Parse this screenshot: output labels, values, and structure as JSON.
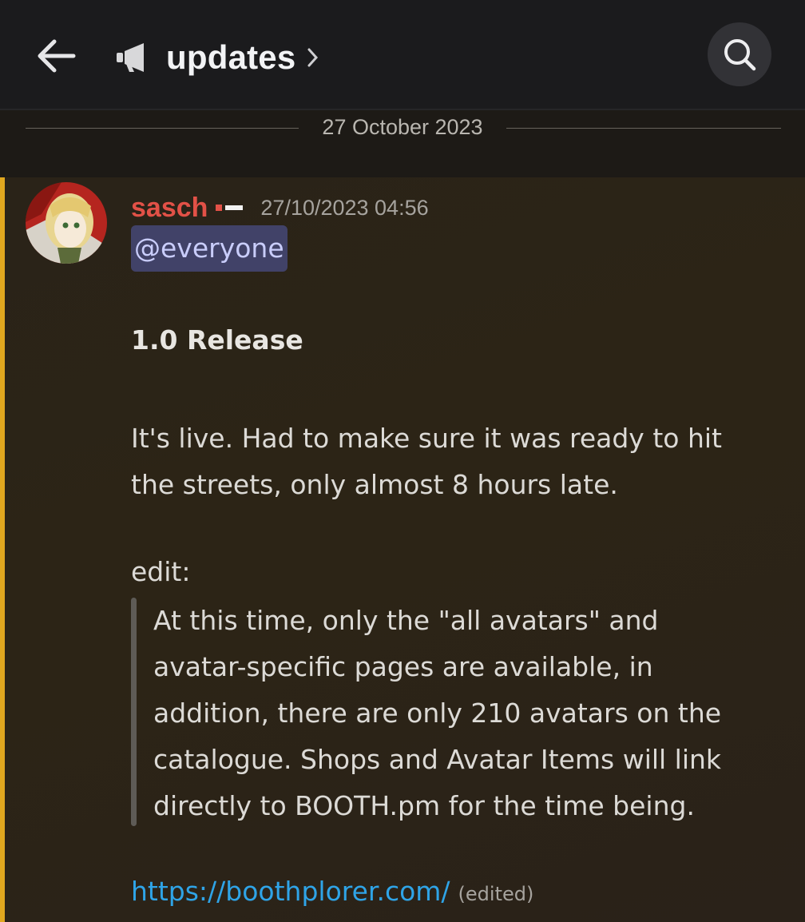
{
  "topbar": {
    "back_icon": "arrow-left-icon",
    "channel_icon": "megaphone-icon",
    "channel_name": "updates",
    "chevron_icon": "chevron-right-icon",
    "search_icon": "search-icon"
  },
  "divider": {
    "date": "27 October 2023"
  },
  "message": {
    "author": "sasch",
    "timestamp": "27/10/2023 04:56",
    "mention": "@everyone",
    "title": "1.0 Release",
    "paragraph_lines": [
      "It's live. Had to make sure it was ready to hit",
      "the streets, only almost 8 hours late."
    ],
    "edit_label": "edit:",
    "quote_lines": [
      "At this time, only the \"all avatars\" and",
      "avatar-specific pages are available, in",
      "addition, there are only 210 avatars on the",
      "catalogue. Shops and Avatar Items will link",
      "directly to BOOTH.pm for the time being."
    ],
    "link": "https://boothplorer.com/",
    "edited_label": "(edited)"
  },
  "colors": {
    "username": "#e25147",
    "mention_bg": "#414268",
    "mention_text": "#c9cdfb",
    "link": "#2fa4e7",
    "mention_bar": "#e0a71f"
  }
}
